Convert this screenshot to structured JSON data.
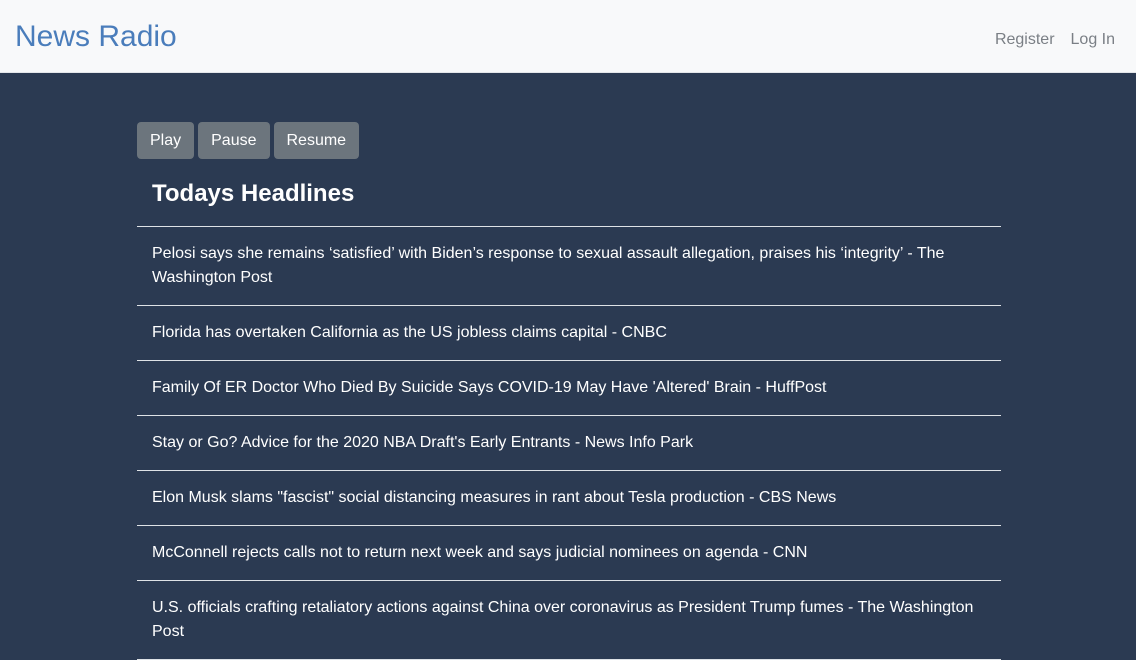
{
  "navbar": {
    "brand": "News Radio",
    "links": [
      "Register",
      "Log In"
    ]
  },
  "controls": {
    "play": "Play",
    "pause": "Pause",
    "resume": "Resume"
  },
  "headlines": {
    "title": "Todays Headlines",
    "items": [
      "Pelosi says she remains ‘satisfied’ with Biden’s response to sexual assault allegation, praises his ‘integrity’ - The Washington Post",
      "Florida has overtaken California as the US jobless claims capital - CNBC",
      "Family Of ER Doctor Who Died By Suicide Says COVID-19 May Have 'Altered' Brain - HuffPost",
      "Stay or Go? Advice for the 2020 NBA Draft's Early Entrants - News Info Park",
      "Elon Musk slams \"fascist\" social distancing measures in rant about Tesla production - CBS News",
      "McConnell rejects calls not to return next week and says judicial nominees on agenda - CNN",
      "U.S. officials crafting retaliatory actions against China over coronavirus as President Trump fumes - The Washington Post"
    ]
  },
  "colors": {
    "background": "#2b3a52",
    "navbar": "#f8f9fa",
    "brand": "#4a7dbb",
    "button": "#6c757d"
  }
}
